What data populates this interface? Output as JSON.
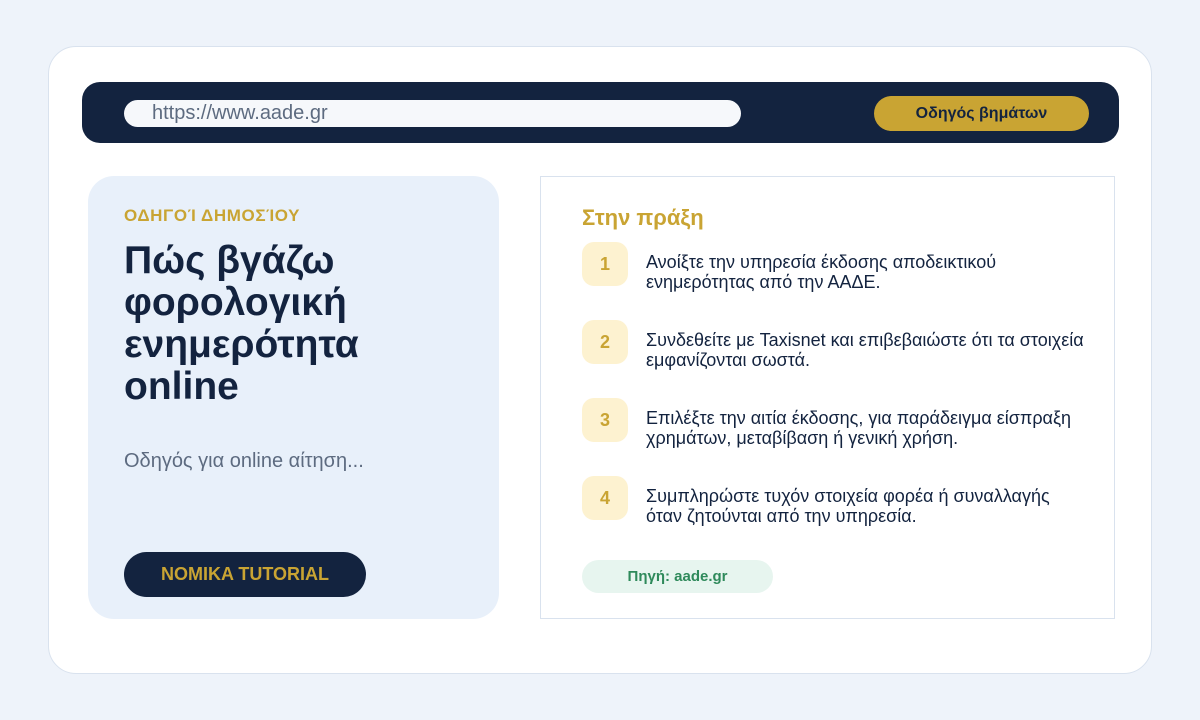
{
  "browser": {
    "url": "https://www.aade.gr",
    "guide_button": "Οδηγός βημάτων"
  },
  "hero": {
    "eyebrow": "ΟΔΗΓΟΊ ΔΗΜΟΣΊΟΥ",
    "title": "Πώς βγάζω φορολογική ενημερότητα online",
    "subtitle": "Οδηγός για online αίτηση...",
    "cta": "NOMIKA TUTORIAL"
  },
  "practice": {
    "title": "Στην πράξη",
    "steps": [
      {
        "num": "1",
        "text": "Ανοίξτε την υπηρεσία έκδοσης αποδεικτικού ενημερότητας από την ΑΑΔΕ."
      },
      {
        "num": "2",
        "text": "Συνδεθείτε με Taxisnet και επιβεβαιώστε ότι τα στοιχεία εμφανίζονται σωστά."
      },
      {
        "num": "3",
        "text": "Επιλέξτε την αιτία έκδοσης, για παράδειγμα είσπραξη χρημάτων, μεταβίβαση ή γενική χρήση."
      },
      {
        "num": "4",
        "text": "Συμπληρώστε τυχόν στοιχεία φορέα ή συναλλαγής όταν ζητούνται από την υπηρεσία."
      }
    ],
    "source": "Πηγή: aade.gr"
  },
  "colors": {
    "navy": "#13233f",
    "gold": "#c9a433",
    "panel": "#e8f0fa",
    "source_green": "#2f8a5b"
  }
}
